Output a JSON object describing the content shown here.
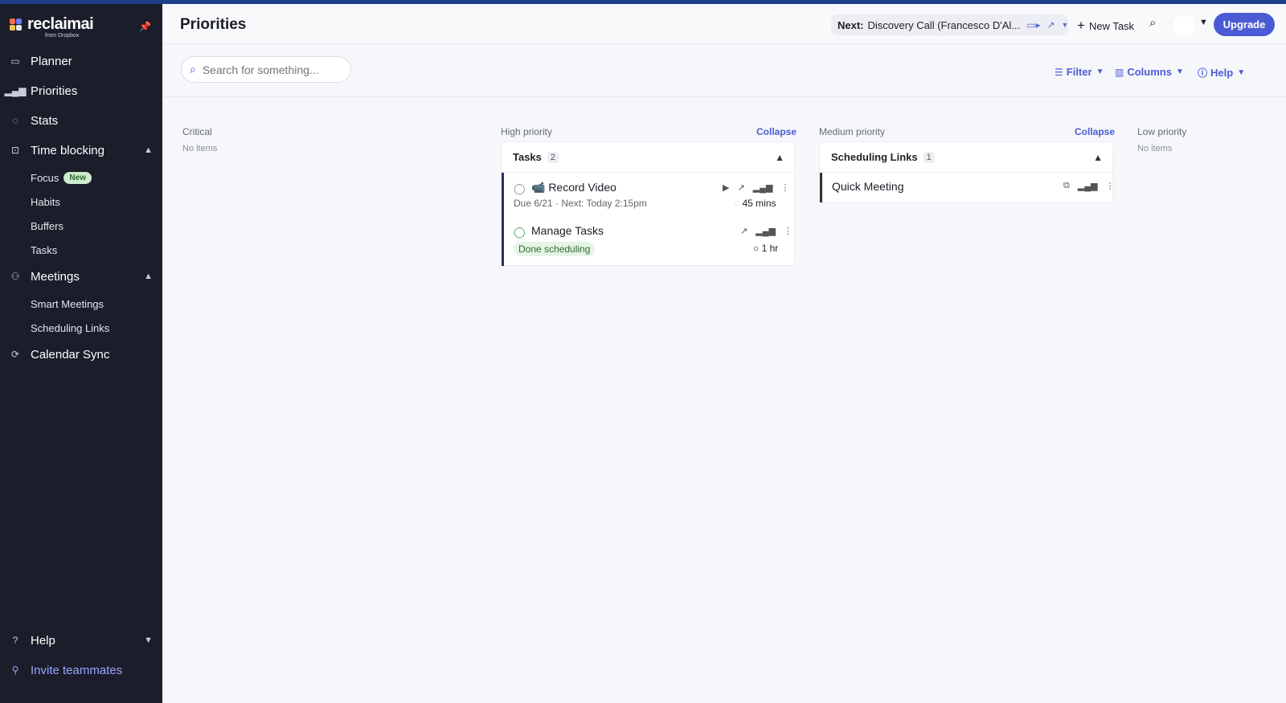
{
  "brand": {
    "name": "reclaimai",
    "sub": "from Dropbox"
  },
  "sidebar": {
    "nav": [
      {
        "label": "Planner",
        "icon": "calendar-icon"
      },
      {
        "label": "Priorities",
        "icon": "bar-chart-icon"
      },
      {
        "label": "Stats",
        "icon": "stats-icon"
      },
      {
        "label": "Time blocking",
        "icon": "time-blocking-icon"
      },
      {
        "label": "Meetings",
        "icon": "meetings-icon"
      },
      {
        "label": "Calendar Sync",
        "icon": "sync-icon"
      }
    ],
    "time_blocking_sub": [
      {
        "label": "Focus",
        "badge": "New"
      },
      {
        "label": "Habits"
      },
      {
        "label": "Buffers"
      },
      {
        "label": "Tasks"
      }
    ],
    "meetings_sub": [
      {
        "label": "Smart Meetings"
      },
      {
        "label": "Scheduling Links"
      }
    ],
    "help": "Help",
    "invite": "Invite teammates"
  },
  "header": {
    "title": "Priorities",
    "next_label": "Next:",
    "next_event": "Discovery Call (Francesco D'Al...",
    "new_task": "New Task",
    "upgrade": "Upgrade"
  },
  "toolbar": {
    "search_placeholder": "Search for something...",
    "filter": "Filter",
    "columns": "Columns",
    "help": "Help"
  },
  "board": {
    "critical": {
      "title": "Critical",
      "empty": "No items"
    },
    "high": {
      "title": "High priority",
      "collapse": "Collapse",
      "group": {
        "title": "Tasks",
        "count": "2"
      },
      "items": [
        {
          "title": "📹 Record Video",
          "meta": "Due 6/21 · Next: Today 2:15pm",
          "duration": "45 mins"
        },
        {
          "title": "Manage Tasks",
          "status": "Done scheduling",
          "duration": "1 hr"
        }
      ]
    },
    "medium": {
      "title": "Medium priority",
      "collapse": "Collapse",
      "group": {
        "title": "Scheduling Links",
        "count": "1"
      },
      "items": [
        {
          "title": "Quick Meeting"
        }
      ]
    },
    "low": {
      "title": "Low priority",
      "empty": "No items"
    }
  },
  "colors": {
    "accent": "#4b5bd6",
    "sidebar_bg": "#1b1d2a"
  }
}
